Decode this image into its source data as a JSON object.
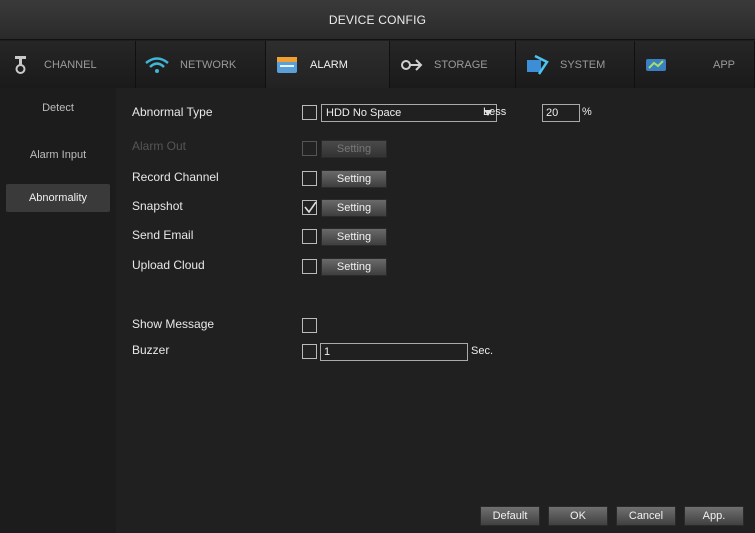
{
  "window": {
    "title": "DEVICE CONFIG"
  },
  "tabs": [
    {
      "label": "CHANNEL",
      "icon": "channel-icon"
    },
    {
      "label": "NETWORK",
      "icon": "wifi-icon"
    },
    {
      "label": "ALARM",
      "icon": "alarm-icon"
    },
    {
      "label": "STORAGE",
      "icon": "storage-icon"
    },
    {
      "label": "SYSTEM",
      "icon": "system-icon"
    },
    {
      "label": "APP",
      "icon": "app-icon"
    }
  ],
  "sidebar": {
    "items": [
      {
        "label": "Detect"
      },
      {
        "label": "Alarm Input"
      },
      {
        "label": "Abnormality"
      }
    ]
  },
  "form": {
    "abnormal_type": {
      "label": "Abnormal Type",
      "value": "HDD No Space",
      "less_label": "Less",
      "less_value": "20",
      "unit": "%"
    },
    "alarm_out": {
      "label": "Alarm Out",
      "setting": "Setting"
    },
    "record_channel": {
      "label": "Record Channel",
      "setting": "Setting"
    },
    "snapshot": {
      "label": "Snapshot",
      "setting": "Setting"
    },
    "send_email": {
      "label": "Send Email",
      "setting": "Setting"
    },
    "upload_cloud": {
      "label": "Upload Cloud",
      "setting": "Setting"
    },
    "show_message": {
      "label": "Show Message"
    },
    "buzzer": {
      "label": "Buzzer",
      "value": "1",
      "unit": "Sec."
    }
  },
  "footer": {
    "default": "Default",
    "ok": "OK",
    "cancel": "Cancel",
    "apply": "App."
  }
}
